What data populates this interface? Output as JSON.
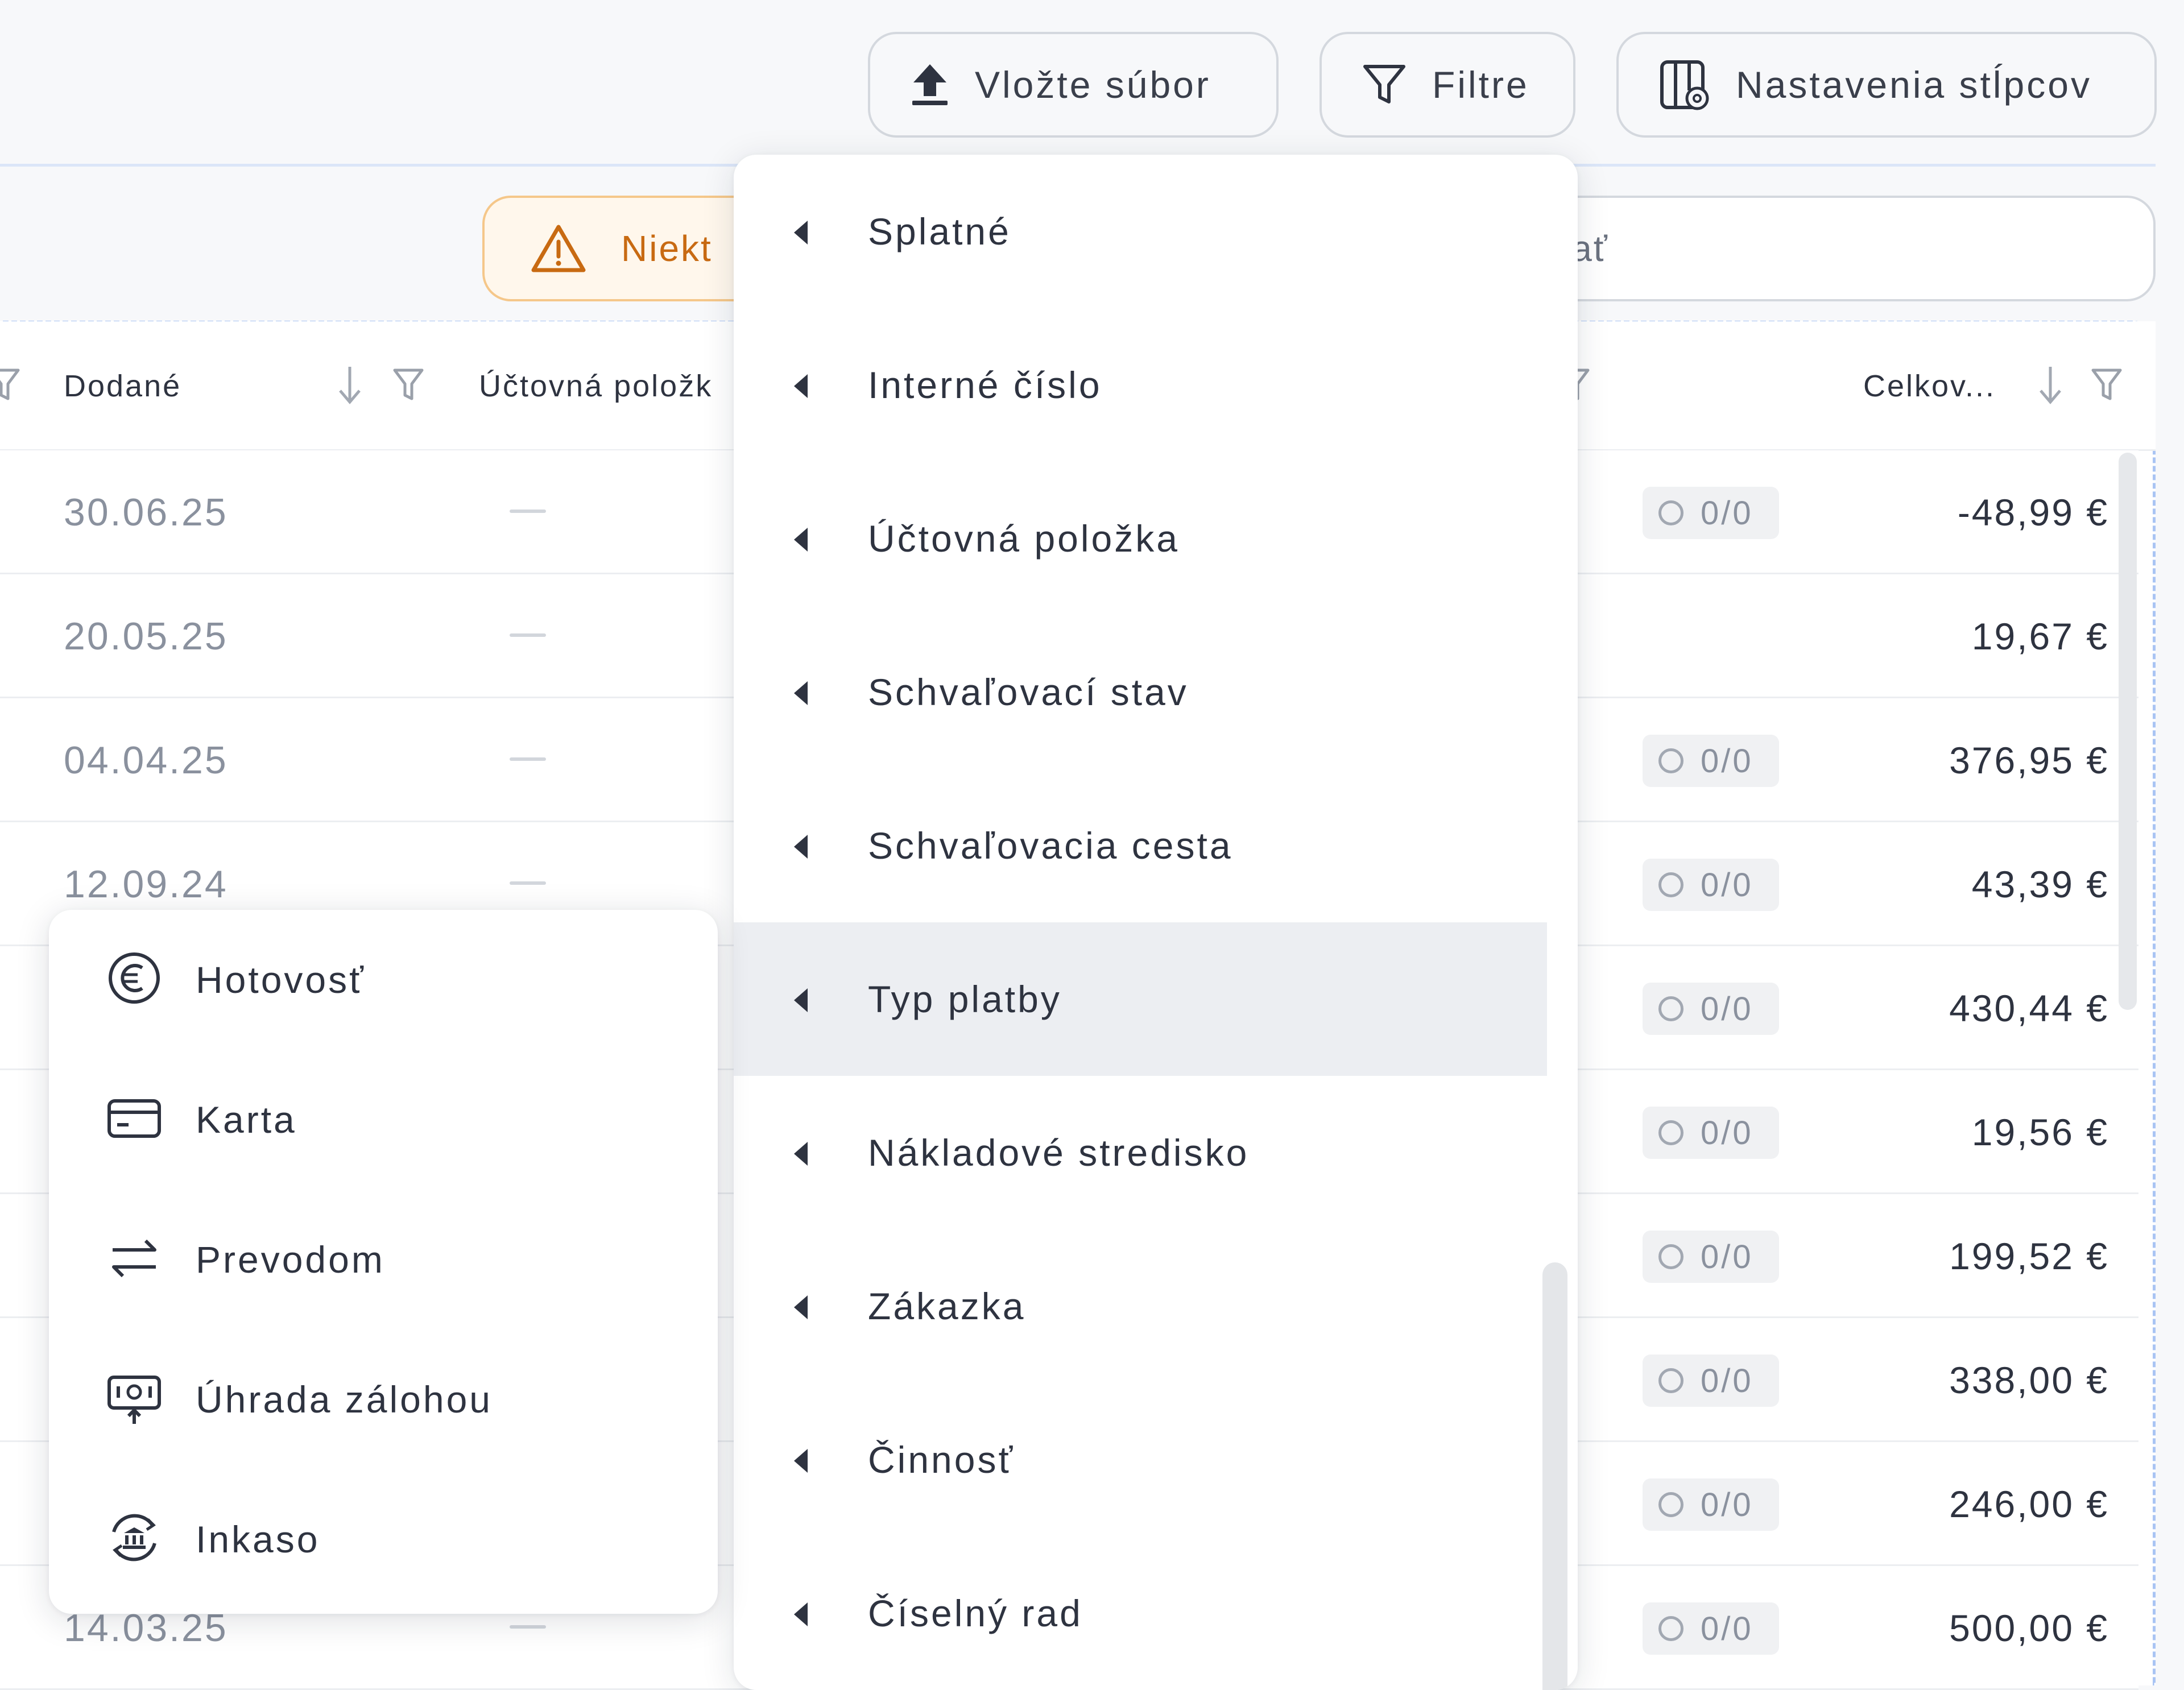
{
  "toolbar": {
    "upload_label": "Vložte súbor",
    "filters_label": "Filtre",
    "columns_label": "Nastavenia stĺpcov"
  },
  "warning": {
    "label": "Niekt"
  },
  "search": {
    "placeholder": "adať"
  },
  "table": {
    "headers": {
      "delivered": "Dodané",
      "account_item": "Účtovná položk",
      "total": "Celkov..."
    },
    "rows": [
      {
        "date": "30.06.25",
        "approval": "0/0",
        "total": "-48,99 €"
      },
      {
        "date": "20.05.25",
        "approval": "",
        "total": "19,67 €"
      },
      {
        "date": "04.04.25",
        "approval": "0/0",
        "total": "376,95 €"
      },
      {
        "date": "12.09.24",
        "approval": "0/0",
        "total": "43,39 €"
      },
      {
        "date": "",
        "approval": "0/0",
        "total": "430,44 €"
      },
      {
        "date": "",
        "approval": "0/0",
        "total": "19,56 €"
      },
      {
        "date": "",
        "approval": "0/0",
        "total": "199,52 €"
      },
      {
        "date": "",
        "approval": "0/0",
        "total": "338,00 €"
      },
      {
        "date": "",
        "approval": "0/0",
        "total": "246,00 €"
      },
      {
        "date": "14.03.25",
        "approval": "0/0",
        "total": "500,00 €"
      }
    ]
  },
  "column_menu": {
    "items": [
      {
        "label": "Splatné"
      },
      {
        "label": "Interné číslo"
      },
      {
        "label": "Účtovná položka"
      },
      {
        "label": "Schvaľovací stav"
      },
      {
        "label": "Schvaľovacia cesta"
      },
      {
        "label": "Typ platby",
        "active": true
      },
      {
        "label": "Nákladové stredisko"
      },
      {
        "label": "Zákazka"
      },
      {
        "label": "Činnosť"
      },
      {
        "label": "Číselný rad"
      }
    ]
  },
  "payment_menu": {
    "items": [
      {
        "label": "Hotovosť",
        "icon": "euro-coin-icon"
      },
      {
        "label": "Karta",
        "icon": "credit-card-icon"
      },
      {
        "label": "Prevodom",
        "icon": "transfer-arrows-icon"
      },
      {
        "label": "Úhrada zálohou",
        "icon": "advance-payment-icon"
      },
      {
        "label": "Inkaso",
        "icon": "direct-debit-bank-icon"
      }
    ]
  },
  "colors": {
    "accent_warning": "#c86a12",
    "dashed_border": "#a9c4f3",
    "active_item_bg": "#eceef2"
  }
}
